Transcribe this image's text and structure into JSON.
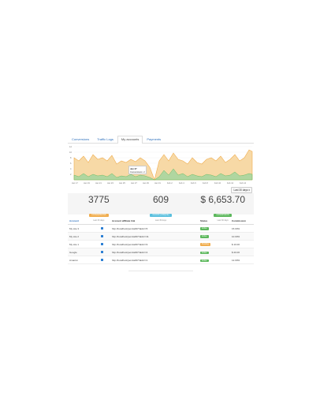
{
  "tabs": [
    "Conversions",
    "Traffic Logs",
    "My accounts",
    "Payments"
  ],
  "active_tab": 2,
  "chart": {
    "y_ticks": [
      "12",
      "10",
      "8",
      "6",
      "4",
      "2"
    ],
    "x_ticks": [
      "Jan 17",
      "Jan 19",
      "Jan 21",
      "Jan 23",
      "Jan 25",
      "Jan 27",
      "Jan 29",
      "Jan 31",
      "Feb 2",
      "Feb 4",
      "Feb 6",
      "Feb 8",
      "Feb 10",
      "Feb 12",
      "Feb 14"
    ],
    "tooltip_date": "Jan 27",
    "tooltip_text": "Conversions: 2",
    "colors": {
      "orange": "#f0ad4e",
      "green": "#5cb85c"
    }
  },
  "range_button": "Last 30 days ▾",
  "stats": [
    {
      "value": "3775",
      "badge": "CONVERSIONS",
      "badge_color": "#f0ad4e",
      "sub": "Last 30 days"
    },
    {
      "value": "609",
      "badge": "CLICKS (UNIQUE)",
      "badge_color": "#5bc0de",
      "sub": "Last 30 days"
    },
    {
      "value": "$ 6,653.70",
      "badge": "COMMISSION",
      "badge_color": "#5cb85c",
      "sub": "Last 30 days"
    }
  ],
  "table": {
    "headers": [
      "Account",
      "",
      "Account affiliate link",
      "Status",
      "Commission"
    ],
    "rows": [
      {
        "account": "My site 3",
        "link": "http://localhost/joomla00/?aklicr=5",
        "status": "Active",
        "status_color": "#5cb85c",
        "commission": "15.00%"
      },
      {
        "account": "My site 2",
        "link": "http://localhost/joomla00/?aklicr=11",
        "status": "Active",
        "status_color": "#5cb85c",
        "commission": "10.00%"
      },
      {
        "account": "My site 1",
        "link": "http://localhost/joomla00/?aklicr=9",
        "status": "Pending",
        "status_color": "#f0ad4e",
        "commission": "$ 10.00"
      },
      {
        "account": "Google",
        "link": "http://localhost/joomla00/?aklicr=4",
        "status": "Active",
        "status_color": "#5cb85c",
        "commission": "$ 20.00"
      },
      {
        "account": "Amazon",
        "link": "http://localhost/joomla00/?aklicr=1",
        "status": "Active",
        "status_color": "#5cb85c",
        "commission": "12.00%"
      }
    ]
  }
}
